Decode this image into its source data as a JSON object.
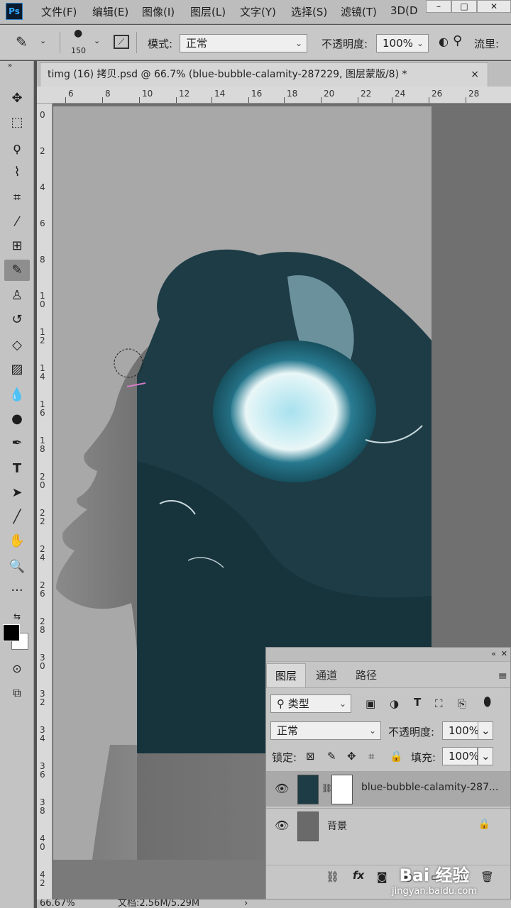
{
  "menubar": {
    "app_logo": "Ps",
    "items": [
      "文件(F)",
      "编辑(E)",
      "图像(I)",
      "图层(L)",
      "文字(Y)",
      "选择(S)",
      "滤镜(T)",
      "3D(D"
    ]
  },
  "options": {
    "brush_size": "150",
    "mode_label": "模式:",
    "mode_value": "正常",
    "opacity_label": "不透明度:",
    "opacity_value": "100%",
    "flow_label": "流里:"
  },
  "document": {
    "tab_title": "timg (16) 拷贝.psd @ 66.7% (blue-bubble-calamity-287229, 图层蒙版/8) *",
    "close": "×"
  },
  "rulers": {
    "horizontal": [
      "6",
      "8",
      "10",
      "12",
      "14",
      "16",
      "18",
      "20",
      "22",
      "24",
      "26",
      "28"
    ],
    "vertical": [
      "0",
      "2",
      "4",
      "6",
      "8",
      "1 0",
      "1 2",
      "1 4",
      "1 6",
      "1 8",
      "2 0",
      "2 2",
      "2 4",
      "2 6",
      "2 8",
      "3 0",
      "3 2",
      "3 4",
      "3 6",
      "3 8",
      "4 0",
      "4 2"
    ]
  },
  "layers_panel": {
    "tabs": [
      "图层",
      "通道",
      "路径"
    ],
    "filter_label": "类型",
    "blend_mode": "正常",
    "opacity_label": "不透明度:",
    "opacity_value": "100%",
    "lock_label": "锁定:",
    "fill_label": "填充:",
    "fill_value": "100%",
    "layers": [
      {
        "name": "blue-bubble-calamity-287...",
        "selected": true
      },
      {
        "name": "背景",
        "selected": false
      }
    ],
    "fx": "fx"
  },
  "status": {
    "zoom": "66.67%",
    "doc_info": "文档:2.56M/5.29M"
  },
  "watermark": {
    "text": "Bai 经验",
    "url": "jingyan.baidu.com"
  },
  "colors": {
    "ocean": "#1d3c45",
    "bubble": "#a8e1ee",
    "accent": "#31a8ff"
  }
}
